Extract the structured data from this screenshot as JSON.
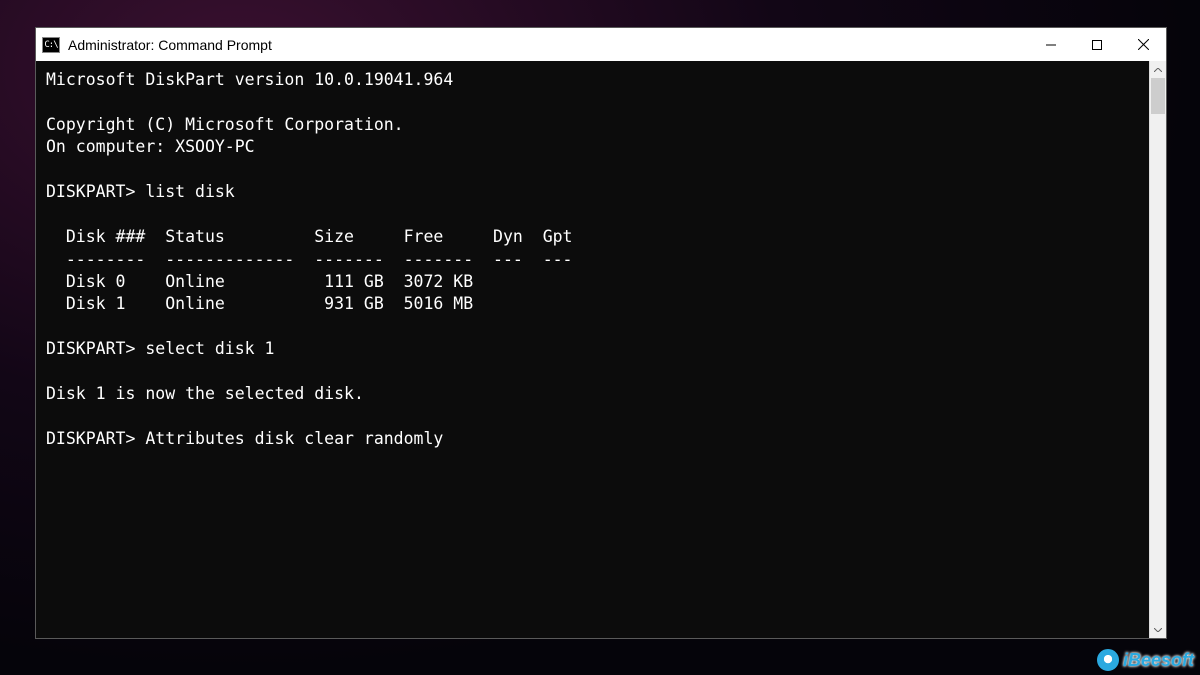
{
  "window": {
    "title": "Administrator: Command Prompt",
    "icon_label": "C:\\"
  },
  "terminal": {
    "header_version": "Microsoft DiskPart version 10.0.19041.964",
    "copyright": "Copyright (C) Microsoft Corporation.",
    "computer_line": "On computer: XSOOY-PC",
    "prompt": "DISKPART>",
    "cmd1": "list disk",
    "table": {
      "header": "  Disk ###  Status         Size     Free     Dyn  Gpt",
      "divider": "  --------  -------------  -------  -------  ---  ---",
      "rows": [
        "  Disk 0    Online          111 GB  3072 KB",
        "  Disk 1    Online          931 GB  5016 MB"
      ]
    },
    "cmd2": "select disk 1",
    "response2": "Disk 1 is now the selected disk.",
    "cmd3": "Attributes disk clear randomly"
  },
  "watermark": {
    "text": "iBeesoft"
  }
}
